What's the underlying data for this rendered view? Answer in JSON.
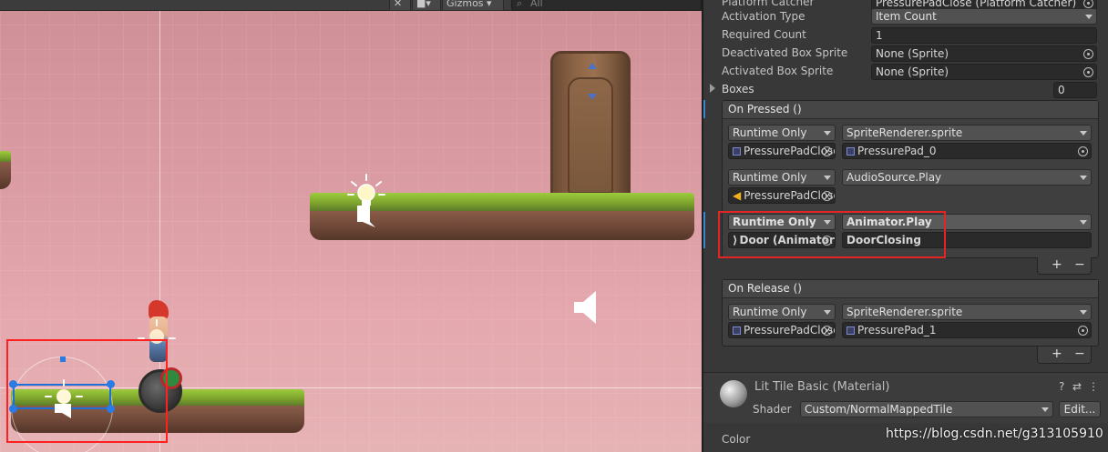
{
  "scene": {
    "gizmos_label": "Gizmos",
    "search_placeholder": "All"
  },
  "inspector": {
    "platform_catcher_value": "PressurePadClose (Platform Catcher)",
    "fields": [
      {
        "label": "Activation Type",
        "value": "Item Count"
      },
      {
        "label": "Required Count",
        "value": "1"
      },
      {
        "label": "Deactivated Box Sprite",
        "value": "None (Sprite)"
      },
      {
        "label": "Activated Box Sprite",
        "value": "None (Sprite)"
      }
    ],
    "boxes": {
      "label": "Boxes",
      "value": "0"
    },
    "on_pressed": {
      "title": "On Pressed ()",
      "entries": [
        {
          "mode": "Runtime Only",
          "function": "SpriteRenderer.sprite",
          "target": "PressurePadClose",
          "arg": "PressurePad_0"
        },
        {
          "mode": "Runtime Only",
          "function": "AudioSource.Play",
          "target": "PressurePadClose",
          "arg": ""
        },
        {
          "mode": "Runtime Only",
          "function": "Animator.Play",
          "target": "Door (Animator)",
          "arg": "DoorClosing"
        }
      ]
    },
    "on_release": {
      "title": "On Release ()",
      "entries": [
        {
          "mode": "Runtime Only",
          "function": "SpriteRenderer.sprite",
          "target": "PressurePadClose",
          "arg": "PressurePad_1"
        }
      ]
    },
    "add_label": "+",
    "remove_label": "−",
    "material": {
      "name": "Lit Tile Basic (Material)",
      "shader_label": "Shader",
      "shader_value": "Custom/NormalMappedTile",
      "edit_label": "Edit...",
      "help_icon": "?",
      "settings_icon": "⇄",
      "menu_icon": "⋮"
    },
    "color_label": "Color"
  },
  "watermark": "https://blog.csdn.net/g313105910",
  "colors": {
    "accent_blue": "#3a86d4",
    "highlight_red": "#e52424"
  }
}
